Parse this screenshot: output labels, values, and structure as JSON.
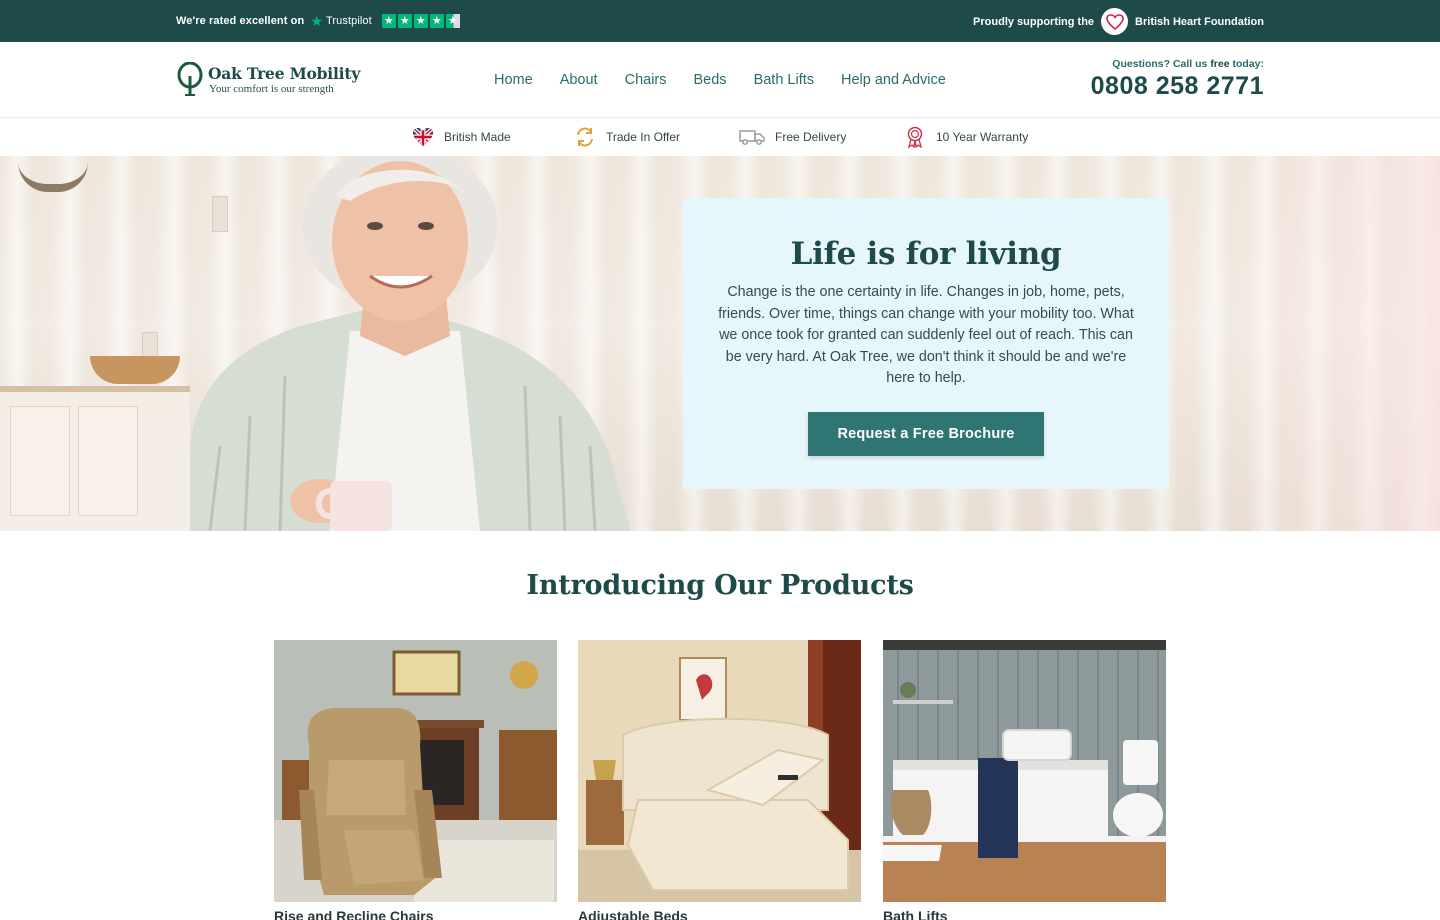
{
  "topbar": {
    "rated_text": "We're rated excellent on",
    "trustpilot": "Trustpilot",
    "support_text": "Proudly supporting the",
    "charity": "British Heart Foundation"
  },
  "header": {
    "logo_name": "Oak Tree Mobility",
    "logo_tagline": "Your comfort is our strength",
    "nav": [
      "Home",
      "About",
      "Chairs",
      "Beds",
      "Bath Lifts",
      "Help and Advice"
    ],
    "call_label_prefix": "Questions? Call us",
    "call_label_free": "free",
    "call_label_suffix": "today:",
    "phone": "0808 258 2771"
  },
  "usp": [
    {
      "label": "British Made",
      "icon": "union-flag-heart-icon"
    },
    {
      "label": "Trade In Offer",
      "icon": "trade-in-arrows-icon"
    },
    {
      "label": "Free Delivery",
      "icon": "delivery-truck-icon"
    },
    {
      "label": "10 Year Warranty",
      "icon": "warranty-rosette-icon"
    }
  ],
  "hero": {
    "title": "Life is for living",
    "text": "Change is the one certainty in life. Changes in job, home, pets, friends. Over time, things can change with your mobility too. What we once took for granted can suddenly feel out of reach. This can be very hard. At Oak Tree, we don't think it should be and we're here to help.",
    "button": "Request a Free Brochure"
  },
  "products": {
    "title": "Introducing Our Products",
    "items": [
      {
        "label": "Rise and Recline Chairs"
      },
      {
        "label": "Adjustable Beds"
      },
      {
        "label": "Bath Lifts"
      }
    ]
  },
  "colors": {
    "topbar_bg": "#1f4a4a",
    "brand_teal": "#2f7574",
    "hero_card_bg": "#e6f7fb",
    "trustpilot_green": "#00b67a"
  }
}
